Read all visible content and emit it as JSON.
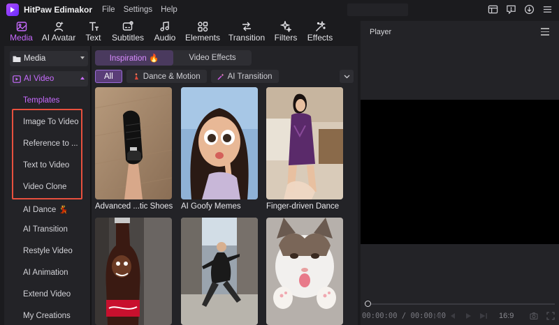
{
  "app": {
    "title": "HitPaw Edimakor"
  },
  "menu": [
    "File",
    "Settings",
    "Help"
  ],
  "toolbar": {
    "items": [
      {
        "label": "Media",
        "icon": "media-icon",
        "active": true
      },
      {
        "label": "AI Avatar",
        "icon": "ai-avatar-icon"
      },
      {
        "label": "Text",
        "icon": "text-icon"
      },
      {
        "label": "Subtitles",
        "icon": "subtitles-icon"
      },
      {
        "label": "Audio",
        "icon": "audio-icon"
      },
      {
        "label": "Elements",
        "icon": "elements-icon"
      },
      {
        "label": "Transition",
        "icon": "transition-icon"
      },
      {
        "label": "Filters",
        "icon": "filters-icon"
      },
      {
        "label": "Effects",
        "icon": "effects-icon"
      }
    ]
  },
  "sidebar": {
    "media_label": "Media",
    "ai_video_label": "AI Video",
    "items": [
      {
        "label": "Templates",
        "active": true
      },
      {
        "label": "Image To Video"
      },
      {
        "label": "Reference to ..."
      },
      {
        "label": "Text to Video"
      },
      {
        "label": "Video Clone"
      },
      {
        "label": "AI Dance 💃"
      },
      {
        "label": "AI Transition"
      },
      {
        "label": "Restyle Video"
      },
      {
        "label": "AI Animation"
      },
      {
        "label": "Extend Video"
      },
      {
        "label": "My Creations"
      }
    ]
  },
  "content": {
    "tabs": [
      {
        "label": "Inspiration 🔥",
        "active": true
      },
      {
        "label": "Video Effects"
      }
    ],
    "chips": [
      {
        "label": "All",
        "active": true
      },
      {
        "label": "Dance & Motion",
        "icon": "dance-icon"
      },
      {
        "label": "AI Transition",
        "icon": "magic-wand-icon"
      }
    ],
    "cards": [
      {
        "label": "Advanced ...tic Shoes"
      },
      {
        "label": "AI Goofy Memes"
      },
      {
        "label": "Finger-driven Dance"
      },
      {
        "label": ""
      },
      {
        "label": ""
      },
      {
        "label": ""
      }
    ]
  },
  "player": {
    "title": "Player",
    "timecode": "00:00:00 / 00:00:00",
    "aspect_ratio": "16:9"
  },
  "colors": {
    "accent": "#c86bff",
    "highlight_box": "#e8503e",
    "panel_bg": "#232327",
    "app_bg": "#1b1b1e"
  }
}
